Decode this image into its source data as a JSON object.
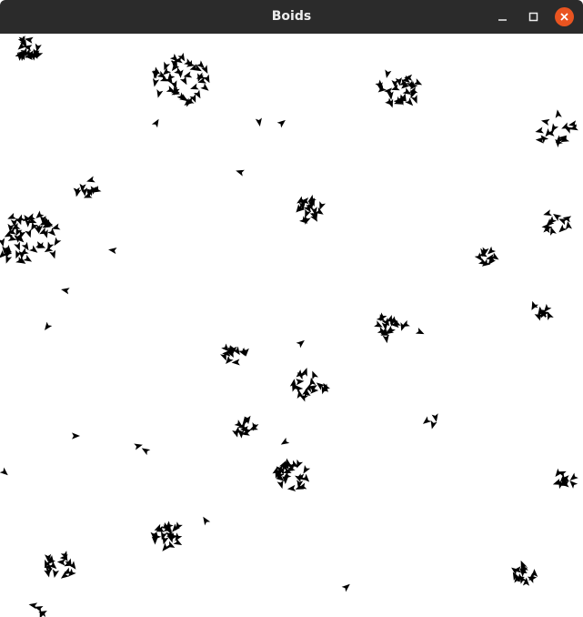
{
  "window": {
    "title": "Boids",
    "controls": {
      "minimize_icon": "minimize-icon",
      "maximize_icon": "maximize-icon",
      "close_icon": "close-icon",
      "close_color": "#e95420"
    }
  },
  "simulation": {
    "background_color": "#ffffff",
    "boid_color": "#000000"
  }
}
